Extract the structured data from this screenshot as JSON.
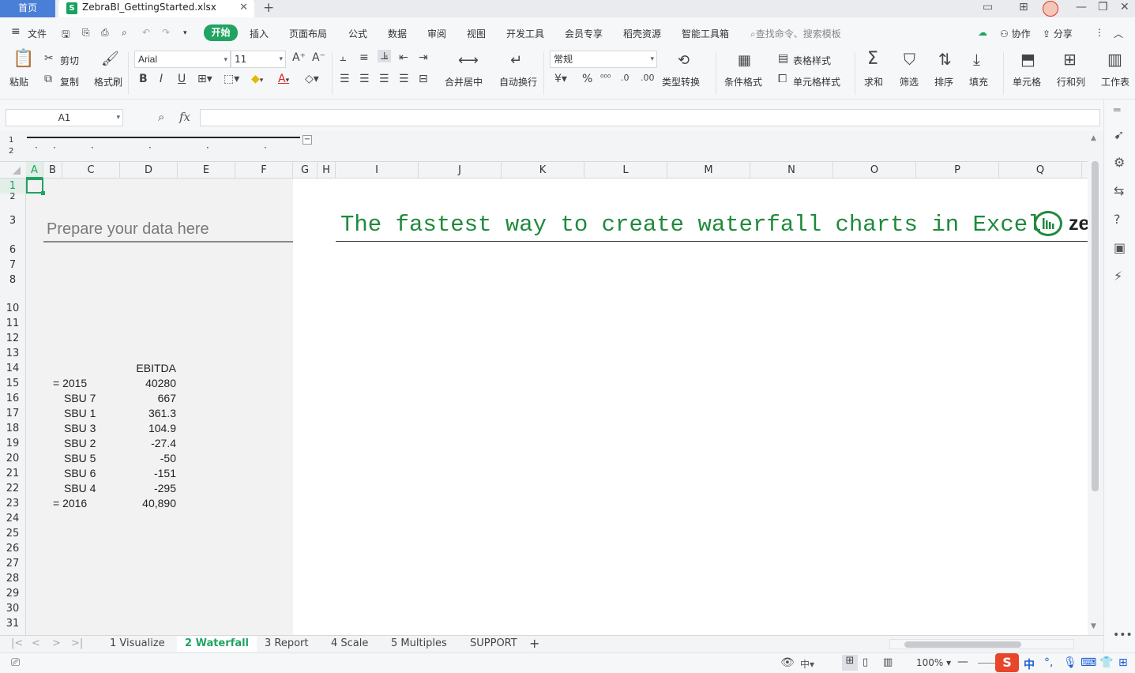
{
  "titlebar": {
    "home_tab": "首页",
    "file_tab": "ZebraBI_GettingStarted.xlsx",
    "file_icon": "S"
  },
  "menu": {
    "file": "文件",
    "active": "开始",
    "items": [
      "插入",
      "页面布局",
      "公式",
      "数据",
      "审阅",
      "视图",
      "开发工具",
      "会员专享",
      "稻壳资源",
      "智能工具箱"
    ],
    "search_placeholder": "查找命令、搜索模板",
    "collab": "协作",
    "share": "分享"
  },
  "ribbon": {
    "paste": "粘贴",
    "cut": "剪切",
    "copy": "复制",
    "format_painter": "格式刷",
    "font_name": "Arial",
    "font_size": "11",
    "merge_center": "合并居中",
    "wrap": "自动换行",
    "number_format": "常规",
    "type_convert": "类型转换",
    "cond_format": "条件格式",
    "table_style": "表格样式",
    "cell_style": "单元格样式",
    "sum": "求和",
    "filter": "筛选",
    "sort": "排序",
    "fill": "填充",
    "cell": "单元格",
    "row_col": "行和列",
    "worksheet": "工作表"
  },
  "formula_bar": {
    "name_box": "A1",
    "fx": "fx",
    "value": ""
  },
  "outline_levels": [
    "1",
    "2"
  ],
  "columns": [
    "A",
    "B",
    "C",
    "D",
    "E",
    "F",
    "G",
    "H",
    "I",
    "J",
    "K",
    "L",
    "M",
    "N",
    "O",
    "P",
    "Q"
  ],
  "rows": [
    "1",
    "2",
    "3",
    "6",
    "7",
    "8",
    "10",
    "11",
    "12",
    "13",
    "14",
    "15",
    "16",
    "17",
    "18",
    "19",
    "20",
    "21",
    "22",
    "23",
    "24",
    "25",
    "26",
    "27",
    "28",
    "29",
    "30",
    "31"
  ],
  "sheet": {
    "prepare_label": "Prepare your data here",
    "headline": "The fastest way to create waterfall charts in Excel",
    "logo_text": "ze",
    "data_header": "EBITDA",
    "data_rows": [
      {
        "label": "= 2015",
        "value": "40280"
      },
      {
        "label": "SBU 7",
        "value": "667"
      },
      {
        "label": "SBU 1",
        "value": "361.3"
      },
      {
        "label": "SBU 3",
        "value": "104.9"
      },
      {
        "label": "SBU 2",
        "value": "-27.4"
      },
      {
        "label": "SBU 5",
        "value": "-50"
      },
      {
        "label": "SBU 6",
        "value": "-151"
      },
      {
        "label": "SBU 4",
        "value": "-295"
      },
      {
        "label": "= 2016",
        "value": "40,890"
      }
    ]
  },
  "sheet_tabs": [
    "1 Visualize",
    "2 Waterfall",
    "3 Report",
    "4 Scale",
    "5 Multiples",
    "SUPPORT"
  ],
  "active_sheet_tab": "2 Waterfall",
  "status": {
    "zoom": "100%",
    "ime_lang": "中"
  },
  "colors": {
    "accent": "#1fa461",
    "headline": "#1f8a3c",
    "home_tab": "#4a7fd7"
  }
}
